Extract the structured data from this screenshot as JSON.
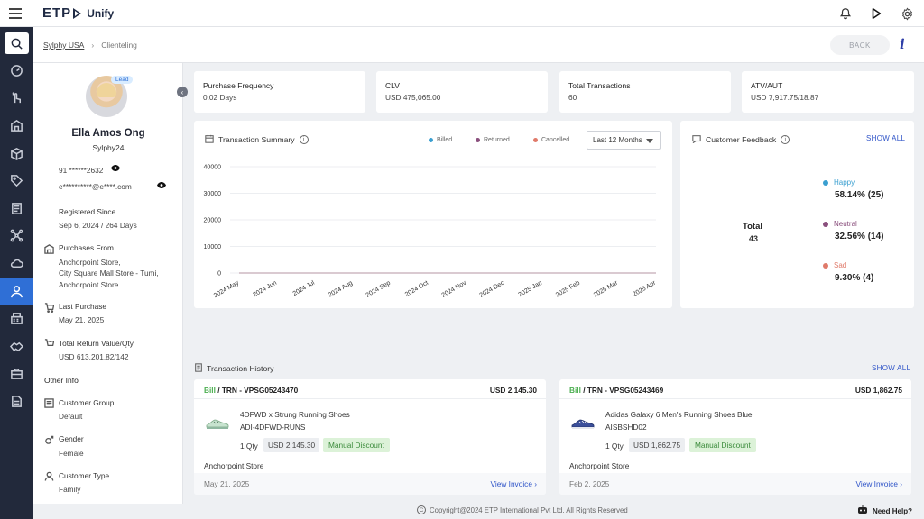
{
  "app": {
    "logo_main": "ETP",
    "logo_sub": "Unify"
  },
  "breadcrumb": {
    "parent": "Sylphy USA",
    "current": "Clienteling"
  },
  "header": {
    "back_label": "BACK",
    "info_label": "i"
  },
  "profile": {
    "badge": "Lead",
    "name": "Ella Amos Ong",
    "username": "Sylphy24",
    "phone": "91 ******2632",
    "email": "e**********@e****.com",
    "registered_label": "Registered Since",
    "registered_value": "Sep 6, 2024 / 264 Days",
    "purchases_from_label": "Purchases From",
    "purchases_from_lines": [
      "Anchorpoint Store,",
      "City Square Mall Store - Tumi,",
      "Anchorpoint Store"
    ],
    "last_purchase_label": "Last Purchase",
    "last_purchase_value": "May 21, 2025",
    "return_label": "Total Return Value/Qty",
    "return_value": "USD 613,201.82/142",
    "other_info_label": "Other Info",
    "customer_group_label": "Customer Group",
    "customer_group_value": "Default",
    "gender_label": "Gender",
    "gender_value": "Female",
    "customer_type_label": "Customer Type",
    "customer_type_value": "Family"
  },
  "kpis": [
    {
      "label": "Purchase Frequency",
      "value": "0.02 Days"
    },
    {
      "label": "CLV",
      "value": "USD 475,065.00"
    },
    {
      "label": "Total Transactions",
      "value": "60"
    },
    {
      "label": "ATV/AUT",
      "value": "USD 7,917.75/18.87"
    }
  ],
  "transaction_summary": {
    "title": "Transaction Summary",
    "legend": [
      {
        "name": "Billed",
        "color": "#3a9fd0"
      },
      {
        "name": "Returned",
        "color": "#8a4f7d"
      },
      {
        "name": "Cancelled",
        "color": "#e07a6a"
      }
    ],
    "period": "Last 12 Months"
  },
  "chart_data": {
    "type": "line",
    "title": "Transaction Summary",
    "x": [
      "2024 May",
      "2024 Jun",
      "2024 Jul",
      "2024 Aug",
      "2024 Sep",
      "2024 Oct",
      "2024 Nov",
      "2024 Dec",
      "2025 Jan",
      "2025 Feb",
      "2025 Mar",
      "2025 Apr"
    ],
    "yticks": [
      "40000",
      "30000",
      "20000",
      "10000",
      "0"
    ],
    "ylim": [
      0,
      40000
    ],
    "series": [
      {
        "name": "Billed",
        "values": [
          0,
          0,
          0,
          0,
          0,
          0,
          0,
          0,
          0,
          0,
          0,
          0
        ]
      },
      {
        "name": "Returned",
        "values": [
          0,
          0,
          0,
          0,
          0,
          0,
          0,
          0,
          0,
          0,
          0,
          0
        ]
      },
      {
        "name": "Cancelled",
        "values": [
          0,
          0,
          0,
          0,
          0,
          0,
          0,
          0,
          0,
          0,
          0,
          0
        ]
      }
    ],
    "grid": true,
    "legend": "top-right"
  },
  "feedback": {
    "title": "Customer Feedback",
    "show_all": "SHOW ALL",
    "total_label": "Total",
    "total_value": "43",
    "items": [
      {
        "name": "Happy",
        "value": "58.14% (25)",
        "color": "#3a9fd0"
      },
      {
        "name": "Neutral",
        "value": "32.56% (14)",
        "color": "#8a4f7d"
      },
      {
        "name": "Sad",
        "value": "9.30% (4)",
        "color": "#e07a6a"
      }
    ]
  },
  "history": {
    "title": "Transaction History",
    "show_all": "SHOW ALL",
    "transactions": [
      {
        "bill": "Bill",
        "trn": " / TRN - VPSG05243470",
        "amount": "USD 2,145.30",
        "product": "4DFWD x Strung Running Shoes",
        "sku": "ADI-4DFWD-RUNS",
        "qty": "1 Qty",
        "price": "USD 2,145.30",
        "discount": "Manual Discount",
        "store": "Anchorpoint Store",
        "date": "May 21, 2025",
        "view": "View Invoice ›"
      },
      {
        "bill": "Bill",
        "trn": " / TRN - VPSG05243469",
        "amount": "USD 1,862.75",
        "product": "Adidas Galaxy 6 Men's Running Shoes Blue",
        "sku": "AISBSHD02",
        "qty": "1 Qty",
        "price": "USD 1,862.75",
        "discount": "Manual Discount",
        "store": "Anchorpoint Store",
        "date": "Feb 2, 2025",
        "view": "View Invoice ›"
      }
    ]
  },
  "footer": {
    "copyright": "Copyright@2024 ETP International Pvt Ltd. All Rights Reserved",
    "help": "Need Help?"
  }
}
